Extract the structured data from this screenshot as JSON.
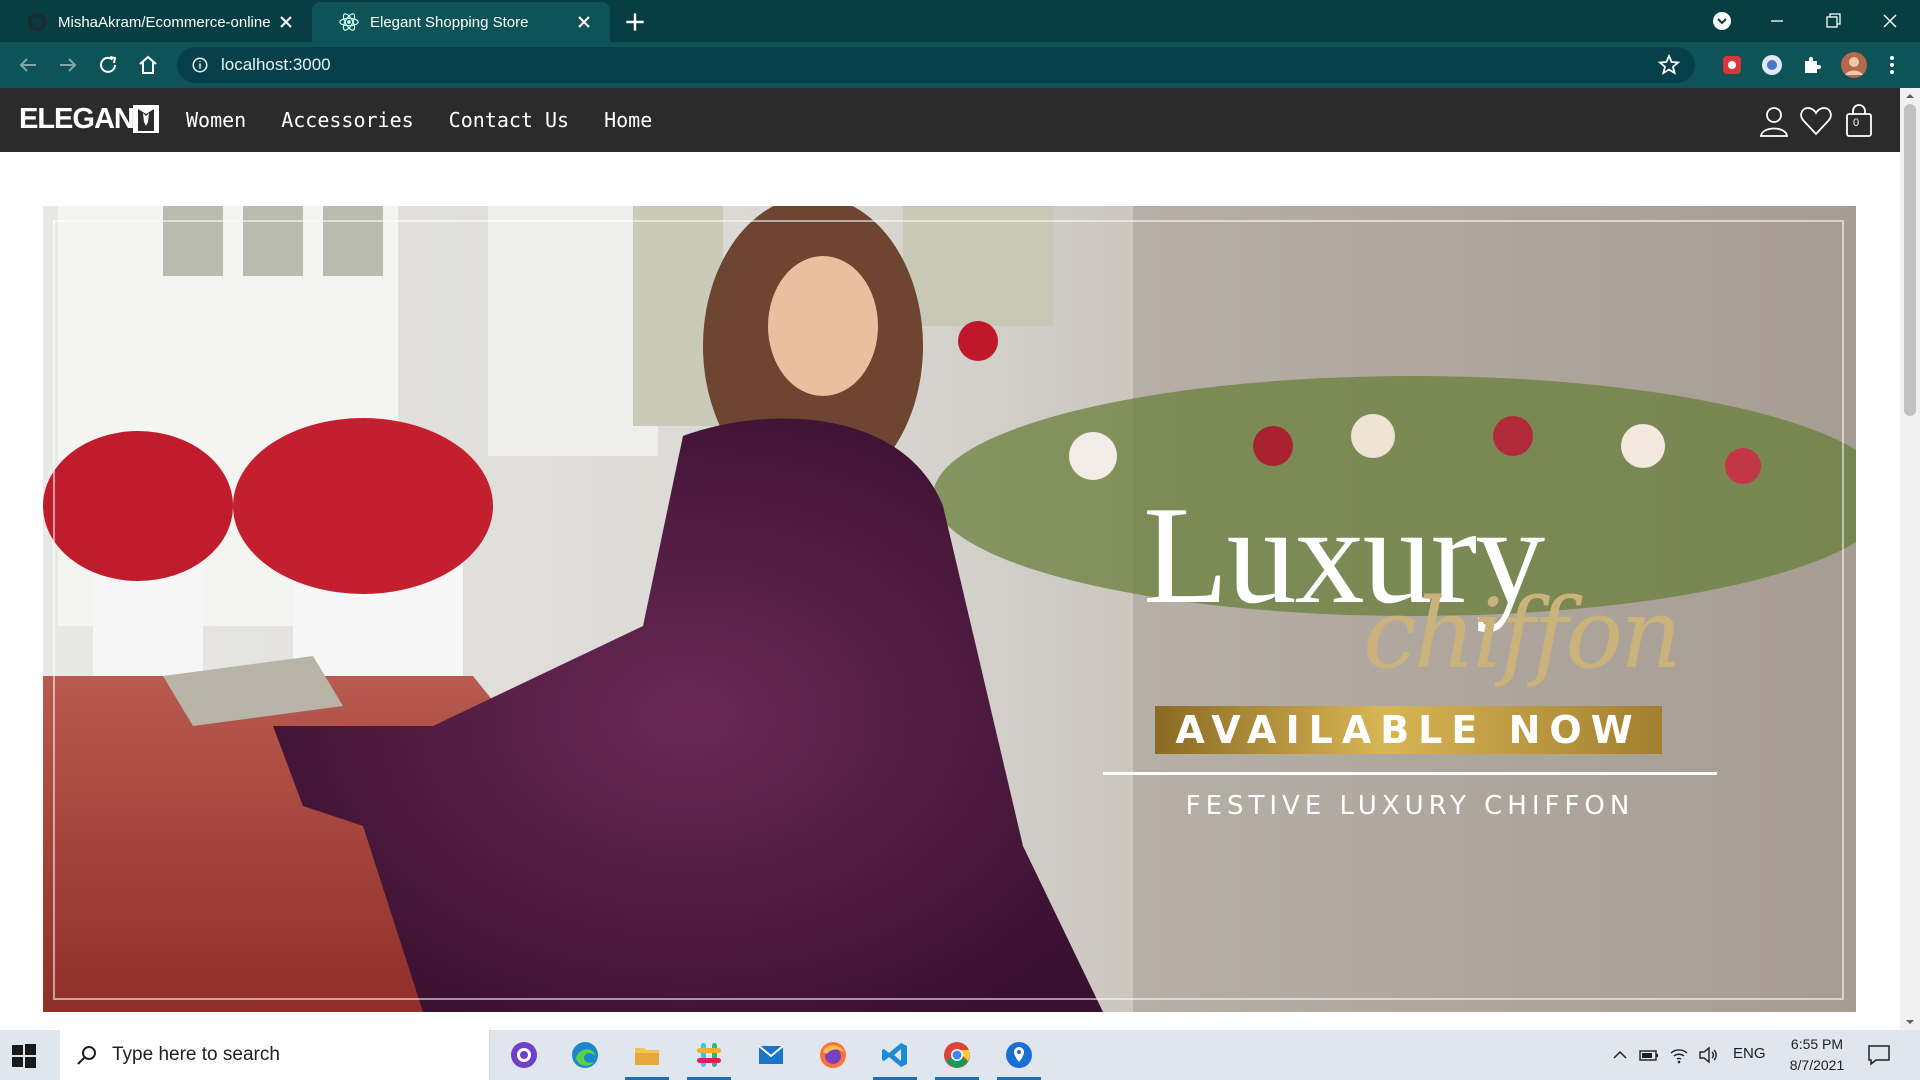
{
  "browser": {
    "tabs": [
      {
        "title": "MishaAkram/Ecommerce-online",
        "active": false
      },
      {
        "title": "Elegant Shopping Store",
        "active": true
      }
    ],
    "url": "localhost:3000"
  },
  "site": {
    "logo_text": "ELEGAN",
    "nav": {
      "women": "Women",
      "accessories": "Accessories",
      "contact": "Contact Us",
      "home": "Home"
    },
    "cart_count": "0"
  },
  "hero": {
    "title": "Luxury",
    "script": "chiffon",
    "badge": "AVAILABLE NOW",
    "subtitle": "FESTIVE LUXURY CHIFFON"
  },
  "taskbar": {
    "search_placeholder": "Type here to search",
    "language": "ENG",
    "time": "6:55 PM",
    "date": "8/7/2021"
  },
  "colors": {
    "tabstrip": "#063e44",
    "toolbar": "#0d5357",
    "site_nav": "#2b2b2b",
    "gold": "#c9b37a",
    "taskbar": "#dfe6ee"
  }
}
